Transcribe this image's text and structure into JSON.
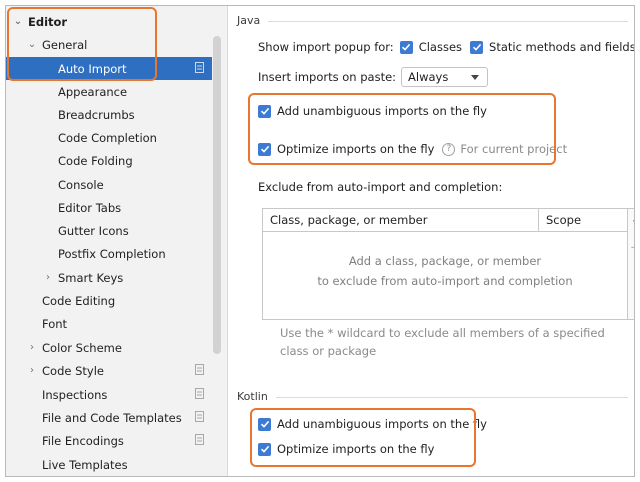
{
  "sidebar": {
    "editor": "Editor",
    "general": "General",
    "auto_import": "Auto Import",
    "appearance": "Appearance",
    "breadcrumbs": "Breadcrumbs",
    "code_completion": "Code Completion",
    "code_folding": "Code Folding",
    "console": "Console",
    "editor_tabs": "Editor Tabs",
    "gutter_icons": "Gutter Icons",
    "postfix_completion": "Postfix Completion",
    "smart_keys": "Smart Keys",
    "code_editing": "Code Editing",
    "font": "Font",
    "color_scheme": "Color Scheme",
    "code_style": "Code Style",
    "inspections": "Inspections",
    "file_code_templates": "File and Code Templates",
    "file_encodings": "File Encodings",
    "live_templates": "Live Templates"
  },
  "java": {
    "title": "Java",
    "popup_label": "Show import popup for:",
    "classes": "Classes",
    "static_methods": "Static methods and fields",
    "insert_label": "Insert imports on paste:",
    "insert_value": "Always",
    "add_unambiguous": "Add unambiguous imports on the fly",
    "optimize": "Optimize imports on the fly",
    "for_current_project": "For current project",
    "exclude_label": "Exclude from auto-import and completion:",
    "col_member": "Class, package, or member",
    "col_scope": "Scope",
    "empty_line1": "Add a class, package, or member",
    "empty_line2": "to exclude from auto-import and completion",
    "note": "Use the * wildcard to exclude all members of a specified class or package",
    "plus": "+",
    "minus": "—"
  },
  "kotlin": {
    "title": "Kotlin",
    "add_unambiguous": "Add unambiguous imports on the fly",
    "optimize": "Optimize imports on the fly"
  },
  "colors": {
    "accent": "#2f6fc2",
    "checkbox": "#3d7ad4",
    "highlight": "#e8762d"
  }
}
